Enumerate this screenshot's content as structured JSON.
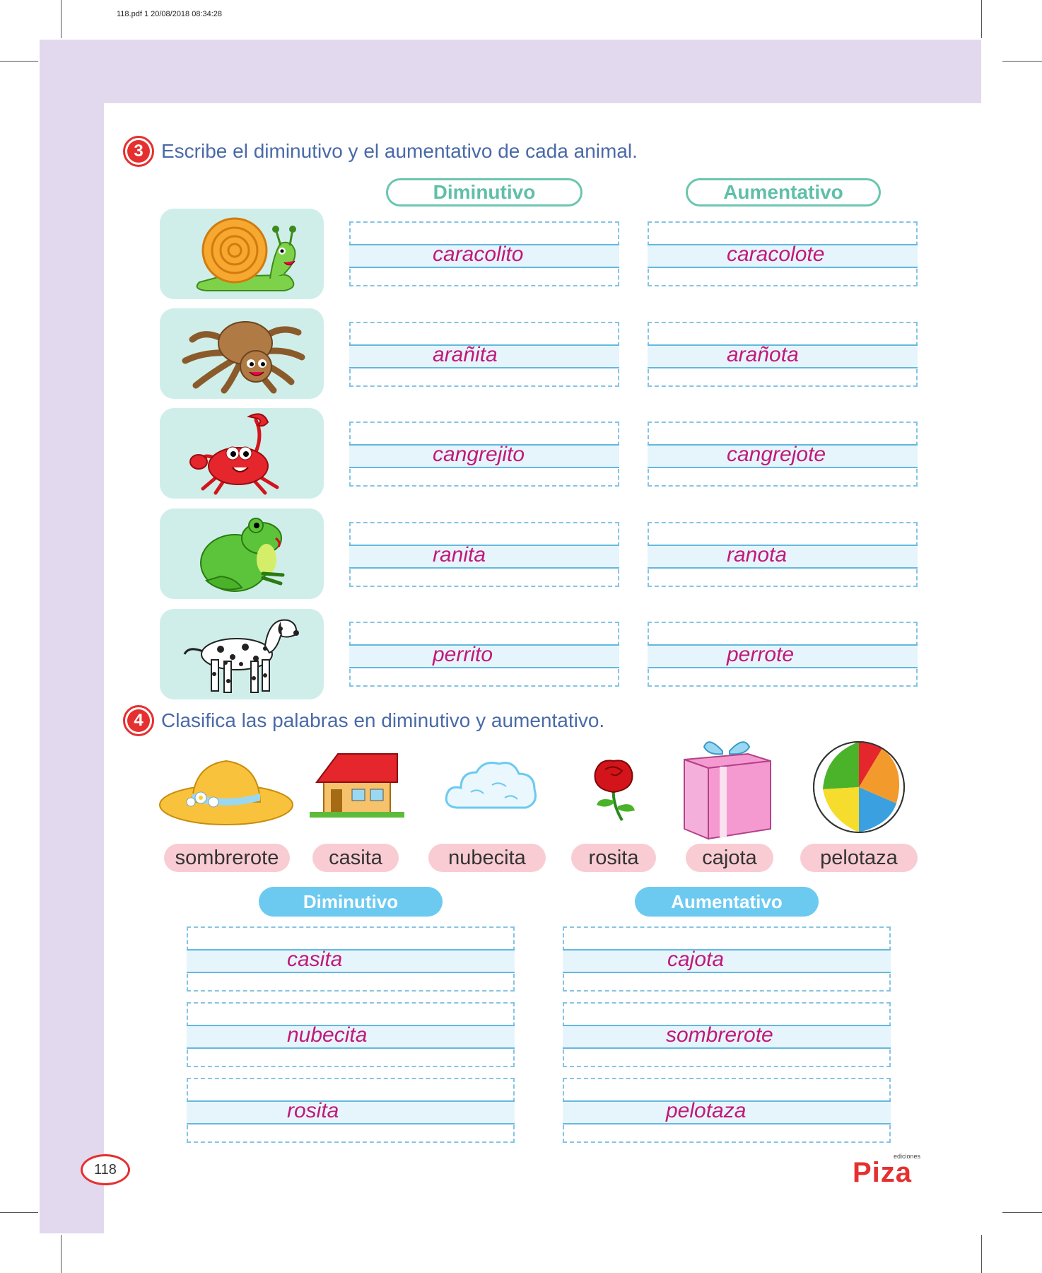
{
  "print_header": "118.pdf   1   20/08/2018   08:34:28",
  "exercise3": {
    "number": "3",
    "instruction": "Escribe el diminutivo y el aumentativo de cada animal.",
    "col_diminutivo": "Diminutivo",
    "col_aumentativo": "Aumentativo",
    "rows": [
      {
        "icon": "snail-icon",
        "diminutivo": "caracolito",
        "aumentativo": "caracolote"
      },
      {
        "icon": "spider-icon",
        "diminutivo": "arañita",
        "aumentativo": "arañota"
      },
      {
        "icon": "crab-icon",
        "diminutivo": "cangrejito",
        "aumentativo": "cangrejote"
      },
      {
        "icon": "frog-icon",
        "diminutivo": "ranita",
        "aumentativo": "ranota"
      },
      {
        "icon": "dalmatian-dog-icon",
        "diminutivo": "perrito",
        "aumentativo": "perrote"
      }
    ]
  },
  "exercise4": {
    "number": "4",
    "instruction": "Clasifica las palabras en diminutivo y aumentativo.",
    "items": [
      {
        "icon": "hat-icon",
        "word": "sombrerote"
      },
      {
        "icon": "house-icon",
        "word": "casita"
      },
      {
        "icon": "cloud-icon",
        "word": "nubecita"
      },
      {
        "icon": "rose-icon",
        "word": "rosita"
      },
      {
        "icon": "gift-box-icon",
        "word": "cajota"
      },
      {
        "icon": "beach-ball-icon",
        "word": "pelotaza"
      }
    ],
    "col_diminutivo": "Diminutivo",
    "col_aumentativo": "Aumentativo",
    "diminutivo_answers": [
      "casita",
      "nubecita",
      "rosita"
    ],
    "aumentativo_answers": [
      "cajota",
      "sombrerote",
      "pelotaza"
    ]
  },
  "page_number": "118",
  "logo": {
    "small": "ediciones",
    "big": "Piza"
  },
  "colors": {
    "accent_red": "#e5302f",
    "answer_magenta": "#c2187a",
    "instruction_blue": "#4a6aa8",
    "teal": "#6cc5b0",
    "sky": "#6ccaf0",
    "purple_band": "#e2d9ee"
  }
}
